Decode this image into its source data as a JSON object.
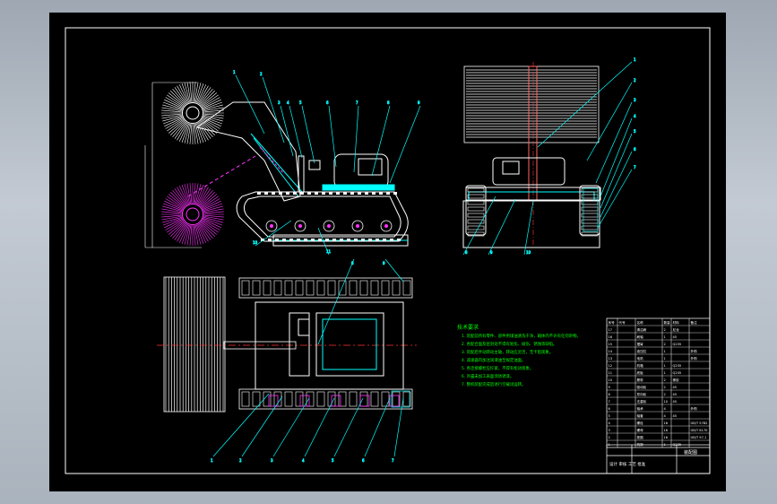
{
  "colors": {
    "background": "#000000",
    "frame": "#ffffff",
    "geometry": "#ffffff",
    "leader": "#00ffff",
    "notes_text": "#00ff00",
    "center_line": "#ff3333",
    "brush_highlight": "#ff33ff",
    "drum": "#ffff66"
  },
  "drawing": {
    "title": "",
    "notes_header": "技术要求",
    "notes": [
      "1. 装配前所有零件、部件用煤油清洗干净，箱体内不许有任何杂物。",
      "2. 各配合面及密封处不得有划伤、碰伤、锈蚀等缺陷。",
      "3. 装配后手动转动主轴，转动应灵活，无卡阻现象。",
      "4. 减速器内加注润滑油至规定油面。",
      "5. 各连接螺栓应拧紧，不得有松动现象。",
      "6. 外露未加工表面涂防锈漆。",
      "7. 整机装配完成后进行空载试运转。"
    ],
    "bom_header": [
      "序号",
      "代号",
      "名称",
      "数量",
      "材料",
      "备注"
    ],
    "bom_rows": [
      [
        "17",
        "",
        "清洁刷",
        "2",
        "尼龙",
        ""
      ],
      [
        "16",
        "",
        "刷轴",
        "1",
        "45",
        ""
      ],
      [
        "15",
        "",
        "摆臂",
        "2",
        "Q235",
        ""
      ],
      [
        "14",
        "",
        "液压缸",
        "1",
        "",
        "外购"
      ],
      [
        "13",
        "",
        "电机",
        "1",
        "",
        "外购"
      ],
      [
        "12",
        "",
        "机箱",
        "1",
        "Q235",
        ""
      ],
      [
        "11",
        "",
        "底板",
        "1",
        "Q235",
        ""
      ],
      [
        "10",
        "",
        "履带",
        "2",
        "橡胶",
        ""
      ],
      [
        "9",
        "",
        "驱动轮",
        "2",
        "45",
        ""
      ],
      [
        "8",
        "",
        "导向轮",
        "2",
        "45",
        ""
      ],
      [
        "7",
        "",
        "支重轮",
        "10",
        "45",
        ""
      ],
      [
        "6",
        "",
        "轴承",
        "4",
        "",
        "外购"
      ],
      [
        "5",
        "",
        "轴套",
        "4",
        "45",
        ""
      ],
      [
        "4",
        "",
        "螺栓",
        "16",
        "",
        "GB/T 5782"
      ],
      [
        "3",
        "",
        "螺母",
        "16",
        "",
        "GB/T 6170"
      ],
      [
        "2",
        "",
        "垫圈",
        "16",
        "",
        "GB/T 97.1"
      ],
      [
        "1",
        "",
        "机架",
        "1",
        "Q235",
        ""
      ]
    ],
    "title_block": {
      "label_left": "设计  审核  工艺  批准",
      "label_right": "装配图"
    },
    "balloons_side": [
      "1",
      "2",
      "3",
      "4",
      "5",
      "6",
      "7",
      "8",
      "9",
      "10",
      "11"
    ],
    "balloons_front": [
      "1",
      "2",
      "3",
      "4",
      "5",
      "6",
      "7",
      "8",
      "9",
      "10"
    ],
    "balloons_plan": [
      "1",
      "2",
      "3",
      "4",
      "5",
      "6",
      "7",
      "8",
      "9"
    ]
  }
}
